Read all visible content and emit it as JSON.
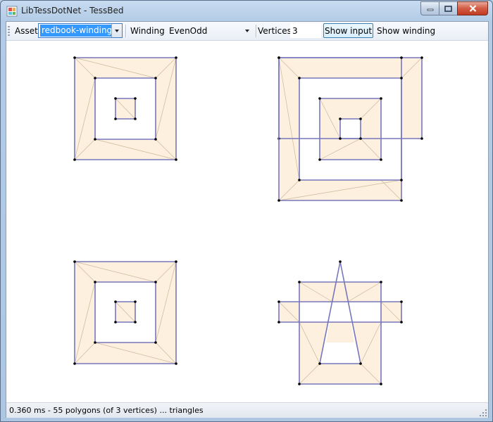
{
  "window": {
    "title": "LibTessDotNet - TessBed",
    "icon": "app-grid-icon",
    "caption_buttons": [
      "minimize-icon",
      "maximize-icon",
      "close-icon"
    ],
    "accent_close": "#c23b22"
  },
  "toolbar": {
    "asset_label": "Asset",
    "asset_value": "redbook-winding",
    "winding_label": "Winding",
    "winding_value": "EvenOdd",
    "vertices_label": "Vertices",
    "vertices_value": "3",
    "show_input_label": "Show input",
    "show_winding_label": "Show winding"
  },
  "canvas": {
    "fill_color": "#fdf0de",
    "triangle_edge_color": "#ccb89a",
    "outline_color": "#7777bb",
    "vertex_color": "#000000"
  },
  "status": {
    "text": "0.360 ms - 55 polygons (of 3 vertices) ... triangles"
  }
}
